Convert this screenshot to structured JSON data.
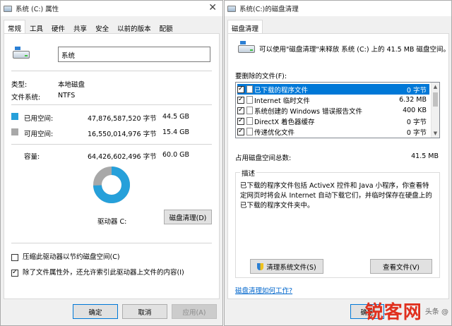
{
  "left": {
    "title": "系统 (C:) 属性",
    "tabs": [
      "常规",
      "工具",
      "硬件",
      "共享",
      "安全",
      "以前的版本",
      "配额"
    ],
    "drive_name": "系统",
    "type_label": "类型:",
    "type_value": "本地磁盘",
    "fs_label": "文件系统:",
    "fs_value": "NTFS",
    "used": {
      "label": "已用空间:",
      "bytes": "47,876,587,520 字节",
      "size": "44.5 GB",
      "color": "#26a0da"
    },
    "free": {
      "label": "可用空间:",
      "bytes": "16,550,014,976 字节",
      "size": "15.4 GB",
      "color": "#a8a8a8"
    },
    "capacity": {
      "label": "容量:",
      "bytes": "64,426,602,496 字节",
      "size": "60.0 GB"
    },
    "used_fraction": 0.743,
    "drive_label": "驱动器 C:",
    "cleanup_button": "磁盘清理(D)",
    "compress_label": "压缩此驱动器以节约磁盘空间(C)",
    "compress_checked": false,
    "index_label": "除了文件属性外，还允许索引此驱动器上文件的内容(I)",
    "index_checked": true,
    "ok": "确定",
    "cancel": "取消",
    "apply": "应用(A)"
  },
  "right": {
    "title": "系统(C:)的磁盘清理",
    "tab": "磁盘清理",
    "intro": "可以使用\"磁盘清理\"来释放 系统 (C:) 上的 41.5 MB 磁盘空间。",
    "files_label": "要删除的文件(F):",
    "items": [
      {
        "name": "已下载的程序文件",
        "size": "0 字节",
        "checked": true,
        "selected": true
      },
      {
        "name": "Internet 临时文件",
        "size": "6.32 MB",
        "checked": true,
        "selected": false
      },
      {
        "name": "系统创建的 Windows 错误报告文件",
        "size": "400 KB",
        "checked": true,
        "selected": false
      },
      {
        "name": "DirectX 着色器缓存",
        "size": "0 字节",
        "checked": true,
        "selected": false
      },
      {
        "name": "传递优化文件",
        "size": "0 字节",
        "checked": true,
        "selected": false
      }
    ],
    "total_label": "占用磁盘空间总数:",
    "total_value": "41.5 MB",
    "desc_title": "描述",
    "desc_text": "已下载的程序文件包括 ActiveX 控件和 Java 小程序，你查看特定网页时将会从 Internet 自动下载它们，并临时保存在硬盘上的已下载的程序文件夹中。",
    "cleanup_system_button": "清理系统文件(S)",
    "view_files_button": "查看文件(V)",
    "how_link": "磁盘清理如何工作?",
    "ok": "确定"
  },
  "watermark": {
    "brand": "锐客网",
    "sub": "头条 @"
  }
}
